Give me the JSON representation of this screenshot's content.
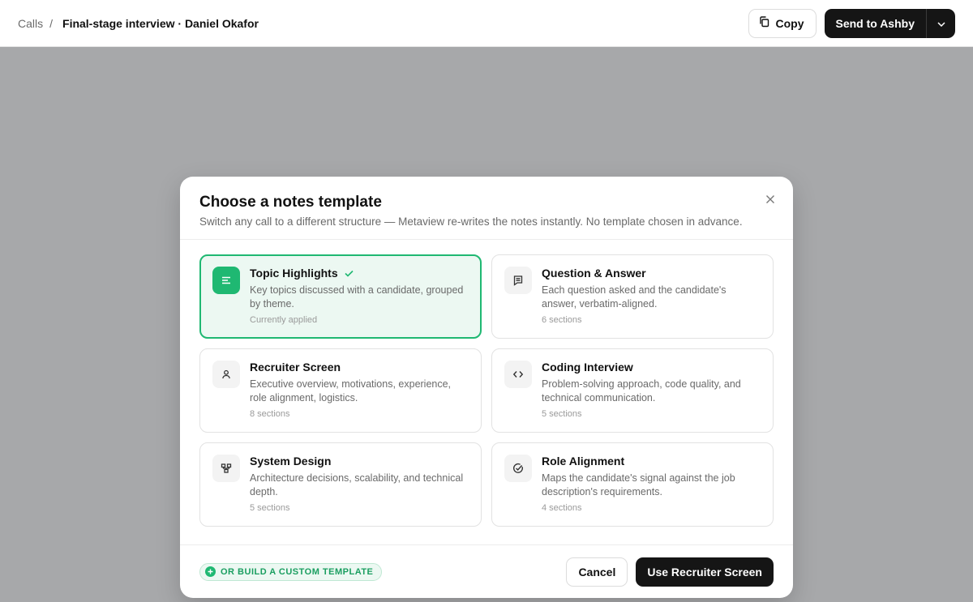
{
  "breadcrumb": {
    "root": "Calls",
    "separator": "/",
    "current": "Final-stage interview · Daniel Okafor"
  },
  "topbar": {
    "copy_label": "Copy",
    "send_label": "Send to Ashby"
  },
  "modal": {
    "title": "Choose a notes template",
    "subtitle": "Switch any call to a different structure — Metaview re-writes the notes instantly. No template chosen in advance.",
    "templates": [
      {
        "title": "Topic Highlights",
        "description": "Key topics discussed with a candidate, grouped by theme.",
        "meta": "Currently applied",
        "icon": "list-icon",
        "selected": true
      },
      {
        "title": "Question & Answer",
        "description": "Each question asked and the candidate's answer, verbatim-aligned.",
        "meta": "6 sections",
        "icon": "message-icon",
        "selected": false
      },
      {
        "title": "Recruiter Screen",
        "description": "Executive overview, motivations, experience, role alignment, logistics.",
        "meta": "8 sections",
        "icon": "person-icon",
        "selected": false
      },
      {
        "title": "Coding Interview",
        "description": "Problem-solving approach, code quality, and technical communication.",
        "meta": "5 sections",
        "icon": "code-icon",
        "selected": false
      },
      {
        "title": "System Design",
        "description": "Architecture decisions, scalability, and technical depth.",
        "meta": "5 sections",
        "icon": "diagram-icon",
        "selected": false
      },
      {
        "title": "Role Alignment",
        "description": "Maps the candidate's signal against the job description's requirements.",
        "meta": "4 sections",
        "icon": "check-circle-icon",
        "selected": false
      }
    ],
    "custom_label": "OR BUILD A CUSTOM TEMPLATE",
    "cancel_label": "Cancel",
    "use_label": "Use Recruiter Screen"
  },
  "colors": {
    "accent": "#1fb872",
    "overlay": "#a7a8aa",
    "primary_button": "#151515"
  }
}
